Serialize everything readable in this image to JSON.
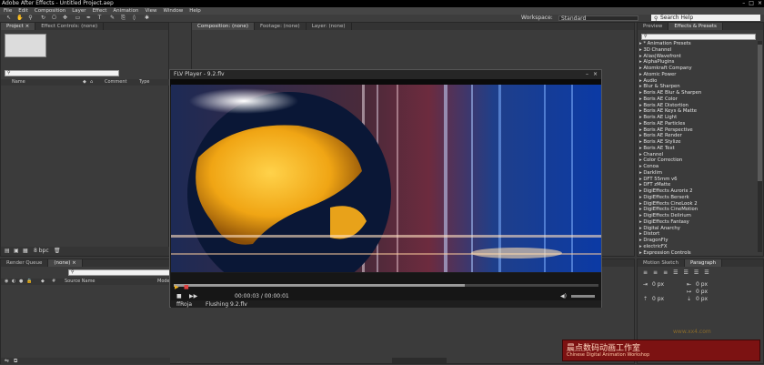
{
  "app": {
    "title": "Adobe After Effects - Untitled Project.aep"
  },
  "menu": [
    "File",
    "Edit",
    "Composition",
    "Layer",
    "Effect",
    "Animation",
    "View",
    "Window",
    "Help"
  ],
  "toolbar": {
    "workspace_label": "Workspace:",
    "workspace_value": "Standard",
    "search_placeholder": "Search Help"
  },
  "project": {
    "tabs": [
      "Project ×",
      "Effect Controls: (none)"
    ],
    "columns": [
      "Name",
      "Comment",
      "Type"
    ],
    "bpc": "8 bpc"
  },
  "composition": {
    "tabs": [
      "Composition: (none)",
      "Footage: (none)",
      "Layer: (none)"
    ]
  },
  "effects": {
    "tabs": [
      "Preview",
      "Effects & Presets"
    ],
    "items": [
      "* Animation Presets",
      "3D Channel",
      "Alias|Wavefront",
      "AlphaPlugins",
      "Atomkraft Company",
      "Atomic Power",
      "Audio",
      "Blur & Sharpen",
      "Boris AE Blur & Sharpen",
      "Boris AE Color",
      "Boris AE Distortion",
      "Boris AE Keys & Matte",
      "Boris AE Light",
      "Boris AE Particles",
      "Boris AE Perspective",
      "Boris AE Render",
      "Boris AE Stylize",
      "Boris AE Text",
      "Channel",
      "Color Correction",
      "Conoa",
      "Darklim",
      "DFT 55mm v6",
      "DFT zMatte",
      "DigiEffects Aurorix 2",
      "DigiEffects Berserk",
      "DigiEffects CineLook 2",
      "DigiEffects CineMotion",
      "DigiEffects Delirium",
      "DigiEffects Fantasy",
      "Digital Anarchy",
      "Distort",
      "DragonFly",
      "electricFX",
      "Expression Controls"
    ]
  },
  "timeline": {
    "tabs": [
      "Render Queue",
      "(none) ×"
    ],
    "columns": [
      "Source Name",
      "Mode"
    ]
  },
  "paragraph": {
    "tabs": [
      "Motion Sketch",
      "Paragraph"
    ],
    "fields": [
      "0 px",
      "0 px",
      "0 px",
      "0 px",
      "0 px"
    ]
  },
  "flv": {
    "title": "FLV Player - 9.2.flv",
    "timecode": "00:00:03 / 00:00:01",
    "status_left": "ffRoja",
    "status_right": "Flushing 9.2.flv"
  },
  "watermark": {
    "cn": "晨点数码动画工作室",
    "en": "Chinese Digital Animation Workshop",
    "url": "www.xx4.com"
  },
  "colors": {
    "accent": "#f2b31e",
    "video_bg": "#06184a",
    "watermark_bg": "#7c1212"
  }
}
